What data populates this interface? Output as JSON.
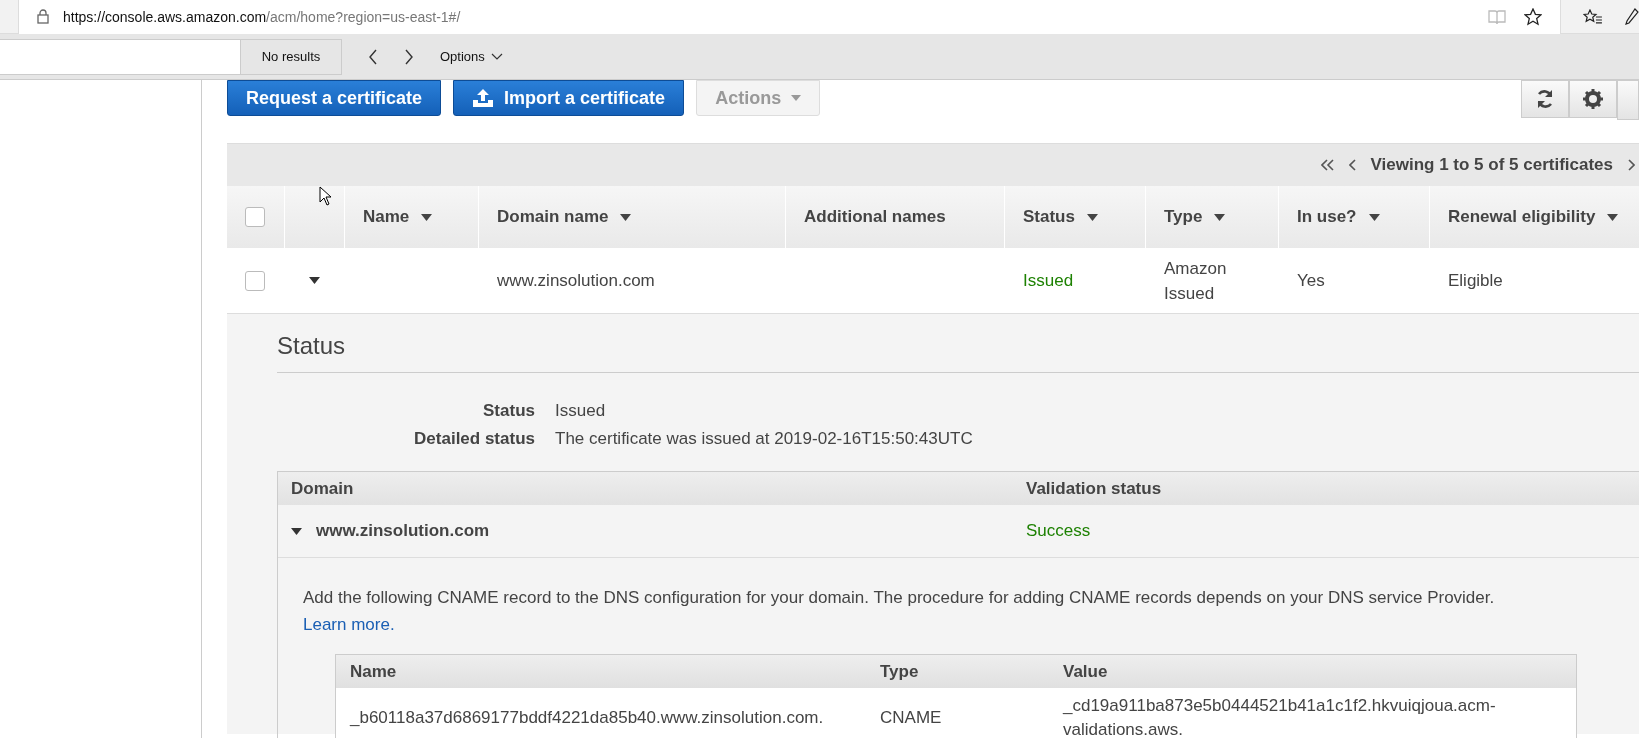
{
  "browser": {
    "url_host": "https://console.aws.amazon.com",
    "url_path": "/acm/home?region=us-east-1#/"
  },
  "find_bar": {
    "result": "No results",
    "options": "Options"
  },
  "toolbar": {
    "buttons": [
      {
        "label": "Request a certificate",
        "kind": "primary"
      },
      {
        "label": "Import a certificate",
        "kind": "import"
      },
      {
        "label": "Actions",
        "kind": "dropdown"
      }
    ]
  },
  "pagination": {
    "text": "Viewing 1 to 5 of 5 certificates"
  },
  "table": {
    "all_checked": false,
    "columns": [
      {
        "label": "Name",
        "sortable": true
      },
      {
        "label": "Domain name",
        "sortable": true
      },
      {
        "label": "Additional names",
        "sortable": false
      },
      {
        "label": "Status",
        "sortable": true
      },
      {
        "label": "Type",
        "sortable": true
      },
      {
        "label": "In use?",
        "sortable": true
      },
      {
        "label": "Renewal eligibility",
        "sortable": true
      }
    ],
    "rows": [
      {
        "checked": false,
        "expanded": true,
        "name": "",
        "domain": "www.zinsolution.com",
        "additional": "",
        "status": "Issued",
        "type": "Amazon Issued",
        "in_use": "Yes",
        "renewal": "Eligible"
      }
    ]
  },
  "detail": {
    "heading": "Status",
    "fields": [
      {
        "label": "Status",
        "value": "Issued"
      },
      {
        "label": "Detailed status",
        "value": "The certificate was issued at 2019-02-16T15:50:43UTC"
      }
    ],
    "domain_columns": [
      "Domain",
      "Validation status"
    ],
    "domains": [
      {
        "domain": "www.zinsolution.com",
        "status": "Success",
        "expanded": true
      }
    ],
    "instructions": "Add the following CNAME record to the DNS configuration for your domain. The procedure for adding CNAME records depends on your DNS service Provider.",
    "learn_more": "Learn more.",
    "record_columns": [
      "Name",
      "Type",
      "Value"
    ],
    "records": [
      {
        "name": "_b60118a37d6869177bddf4221da85b40.www.zinsolution.com.",
        "type": "CNAME",
        "value": "_cd19a911ba873e5b0444521b41a1c1f2.hkvuiqjoua.acm-validations.aws."
      }
    ]
  }
}
